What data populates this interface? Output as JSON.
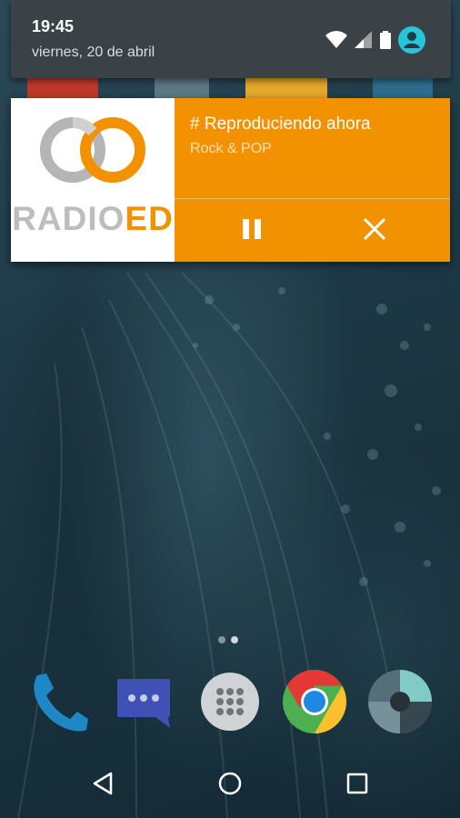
{
  "status_bar": {
    "time": "19:45",
    "date": "viernes, 20 de abril"
  },
  "notification": {
    "title": "# Reproduciendo ahora",
    "subtitle": "Rock & POP",
    "logo": {
      "text_part1": "RADIO",
      "text_part2": "ED"
    },
    "accent_color": "#f39200",
    "actions": [
      {
        "icon": "pause-icon"
      },
      {
        "icon": "close-icon"
      }
    ]
  },
  "home": {
    "page_dots": 2,
    "dock": [
      {
        "app": "phone",
        "icon": "phone-icon"
      },
      {
        "app": "messages",
        "icon": "chat-icon"
      },
      {
        "app": "app-drawer",
        "icon": "apps-grid-icon"
      },
      {
        "app": "chrome",
        "icon": "chrome-icon"
      },
      {
        "app": "camera",
        "icon": "camera-icon"
      }
    ]
  },
  "nav_bar": {
    "buttons": [
      "back-icon",
      "home-icon",
      "recents-icon"
    ]
  }
}
